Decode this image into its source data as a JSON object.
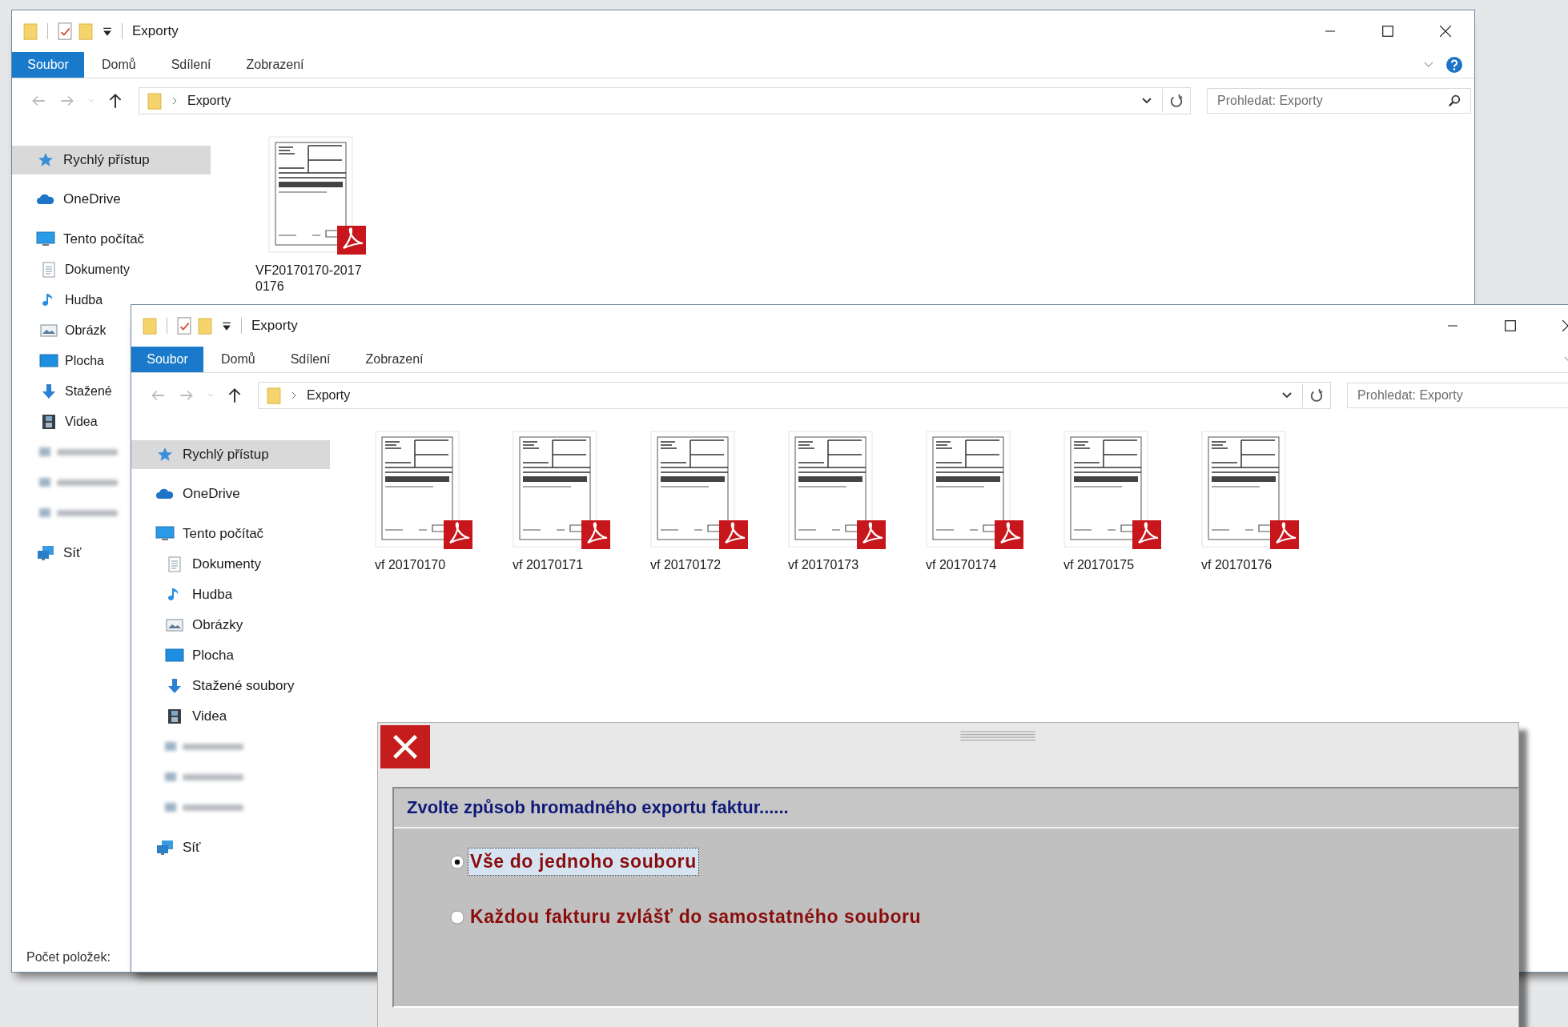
{
  "windows": [
    {
      "title": "Exporty",
      "help_button": true,
      "ribbon_tabs": [
        {
          "label": "Soubor",
          "selected": true
        },
        {
          "label": "Domů",
          "selected": false
        },
        {
          "label": "Sdílení",
          "selected": false
        },
        {
          "label": "Zobrazení",
          "selected": false
        }
      ],
      "address": {
        "path": "Exporty"
      },
      "search": {
        "placeholder": "Prohledat: Exporty"
      },
      "nav_items": [
        {
          "kind": "star",
          "label": "Rychlý přístup",
          "selected": true
        },
        {
          "kind": "cloud",
          "label": "OneDrive",
          "selected": false
        },
        {
          "kind": "computer",
          "label": "Tento počítač",
          "selected": false,
          "children": [
            {
              "kind": "documents",
              "label": "Dokumenty",
              "selected": false
            },
            {
              "kind": "music",
              "label": "Hudba",
              "selected": false
            },
            {
              "kind": "pictures",
              "label": "Obrázk",
              "selected": false
            },
            {
              "kind": "desktop",
              "label": "Plocha",
              "selected": false
            },
            {
              "kind": "downloads",
              "label": "Stažené",
              "selected": false
            },
            {
              "kind": "videos",
              "label": "Videa",
              "selected": false
            },
            {
              "kind": "blurred",
              "selected": false
            },
            {
              "kind": "blurred",
              "selected": false
            },
            {
              "kind": "blurred",
              "selected": false
            }
          ]
        },
        {
          "kind": "network",
          "label": "Síť",
          "selected": false
        }
      ],
      "files": [
        {
          "name": "VF20170170-20170176"
        }
      ],
      "status_bar": "Počet položek:"
    },
    {
      "title": "Exporty",
      "help_button": false,
      "ribbon_tabs": [
        {
          "label": "Soubor",
          "selected": true
        },
        {
          "label": "Domů",
          "selected": false
        },
        {
          "label": "Sdílení",
          "selected": false
        },
        {
          "label": "Zobrazení",
          "selected": false
        }
      ],
      "address": {
        "path": "Exporty"
      },
      "search": {
        "placeholder": "Prohledat: Exporty"
      },
      "nav_items": [
        {
          "kind": "star",
          "label": "Rychlý přístup",
          "selected": true
        },
        {
          "kind": "cloud",
          "label": "OneDrive",
          "selected": false
        },
        {
          "kind": "computer",
          "label": "Tento počítač",
          "selected": false,
          "children": [
            {
              "kind": "documents",
              "label": "Dokumenty",
              "selected": false
            },
            {
              "kind": "music",
              "label": "Hudba",
              "selected": false
            },
            {
              "kind": "pictures",
              "label": "Obrázky",
              "selected": false
            },
            {
              "kind": "desktop",
              "label": "Plocha",
              "selected": false
            },
            {
              "kind": "downloads",
              "label": "Stažené soubory",
              "selected": false
            },
            {
              "kind": "videos",
              "label": "Videa",
              "selected": false
            },
            {
              "kind": "blurred",
              "selected": false
            },
            {
              "kind": "blurred",
              "selected": false
            },
            {
              "kind": "blurred",
              "selected": false
            }
          ]
        },
        {
          "kind": "network",
          "label": "Síť",
          "selected": false
        }
      ],
      "files": [
        {
          "name": "vf 20170170"
        },
        {
          "name": "vf 20170171"
        },
        {
          "name": "vf 20170172"
        },
        {
          "name": "vf 20170173"
        },
        {
          "name": "vf 20170174"
        },
        {
          "name": "vf 20170175"
        },
        {
          "name": "vf 20170176"
        }
      ]
    }
  ],
  "dialog": {
    "heading": "Zvolte způsob hromadného exportu faktur......",
    "options": [
      {
        "label": "Vše do jednoho souboru",
        "selected": true
      },
      {
        "label": "Každou fakturu zvlášť do samostatného souboru",
        "selected": false
      }
    ]
  }
}
